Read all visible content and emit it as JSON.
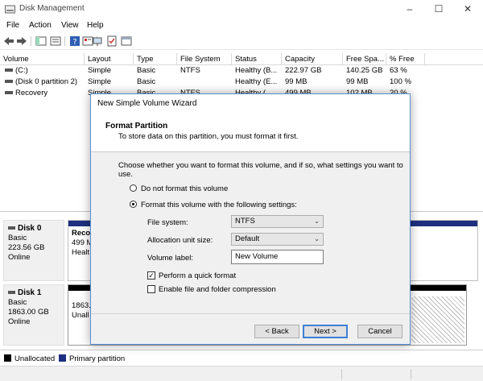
{
  "window": {
    "title": "Disk Management"
  },
  "menu": [
    "File",
    "Action",
    "View",
    "Help"
  ],
  "columns": [
    "Volume",
    "Layout",
    "Type",
    "File System",
    "Status",
    "Capacity",
    "Free Spa...",
    "% Free"
  ],
  "volumes": [
    {
      "volume": "(C:)",
      "layout": "Simple",
      "type": "Basic",
      "fs": "NTFS",
      "status": "Healthy (B...",
      "capacity": "222.97 GB",
      "free": "140.25 GB",
      "pct": "63 %"
    },
    {
      "volume": "(Disk 0 partition 2)",
      "layout": "Simple",
      "type": "Basic",
      "fs": "",
      "status": "Healthy (E...",
      "capacity": "99 MB",
      "free": "99 MB",
      "pct": "100 %"
    },
    {
      "volume": "Recovery",
      "layout": "Simple",
      "type": "Basic",
      "fs": "NTFS",
      "status": "Healthy (...",
      "capacity": "499 MB",
      "free": "102 MB",
      "pct": "20 %"
    }
  ],
  "disks": [
    {
      "name": "Disk 0",
      "type": "Basic",
      "size": "223.56 GB",
      "state": "Online",
      "partition": {
        "name": "Reco",
        "size": "499 M",
        "status": "Healt"
      }
    },
    {
      "name": "Disk 1",
      "type": "Basic",
      "size": "1863.00 GB",
      "state": "Online",
      "partition": {
        "size": "1863.",
        "status": "Unall"
      }
    }
  ],
  "legend": {
    "unallocated": "Unallocated",
    "primary": "Primary partition"
  },
  "colors": {
    "primary": "#1f2f7f",
    "unallocated": "#000000",
    "accent": "#3c7fd6"
  },
  "wizard": {
    "title": "New Simple Volume Wizard",
    "heading": "Format Partition",
    "subheading": "To store data on this partition, you must format it first.",
    "instruction": "Choose whether you want to format this volume, and if so, what settings you want to use.",
    "option_no_format": "Do not format this volume",
    "option_format": "Format this volume with the following settings:",
    "fs_label": "File system:",
    "fs_value": "NTFS",
    "alloc_label": "Allocation unit size:",
    "alloc_value": "Default",
    "vol_label": "Volume label:",
    "vol_value": "New Volume",
    "quick_format": "Perform a quick format",
    "compression": "Enable file and folder compression",
    "back": "< Back",
    "next": "Next >",
    "cancel": "Cancel"
  }
}
